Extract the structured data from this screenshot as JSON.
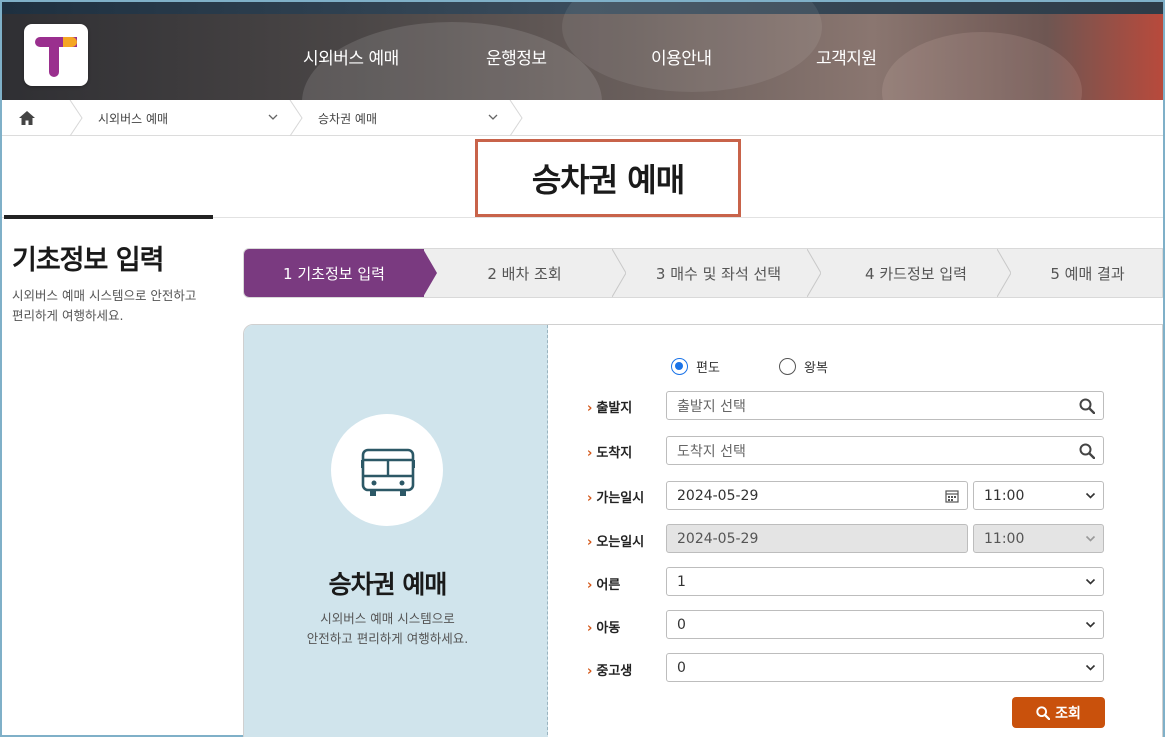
{
  "header": {
    "nav": [
      "시외버스 예매",
      "운행정보",
      "이용안내",
      "고객지원"
    ]
  },
  "breadcrumb": {
    "items": [
      "시외버스 예매",
      "승차권 예매"
    ]
  },
  "page": {
    "title": "승차권 예매"
  },
  "section": {
    "title": "기초정보 입력",
    "desc": "시외버스 예매 시스템으로 안전하고 편리하게 여행하세요."
  },
  "stepper": {
    "steps": [
      "1 기초정보 입력",
      "2 배차 조회",
      "3 매수 및 좌석 선택",
      "4 카드정보 입력",
      "5 예매 결과"
    ],
    "active_index": 0
  },
  "card": {
    "title": "승차권 예매",
    "desc_line1": "시외버스 예매 시스템으로",
    "desc_line2": "안전하고 편리하게 여행하세요."
  },
  "form": {
    "trip_type": {
      "one_way": "편도",
      "round_trip": "왕복",
      "selected": "편도"
    },
    "departure": {
      "label": "출발지",
      "placeholder": "출발지 선택"
    },
    "arrival": {
      "label": "도착지",
      "placeholder": "도착지 선택"
    },
    "depart_date": {
      "label": "가는일시",
      "date": "2024-05-29",
      "time": "11:00"
    },
    "return_date": {
      "label": "오는일시",
      "date": "2024-05-29",
      "time": "11:00"
    },
    "adult": {
      "label": "어른",
      "value": "1"
    },
    "child": {
      "label": "아동",
      "value": "0"
    },
    "student": {
      "label": "중고생",
      "value": "0"
    },
    "search_button": "조회"
  },
  "colors": {
    "accent_purple": "#7a3a80",
    "search_button": "#c9510c",
    "label_arrow": "#d4581a",
    "card_left_bg": "#d0e4ec"
  }
}
